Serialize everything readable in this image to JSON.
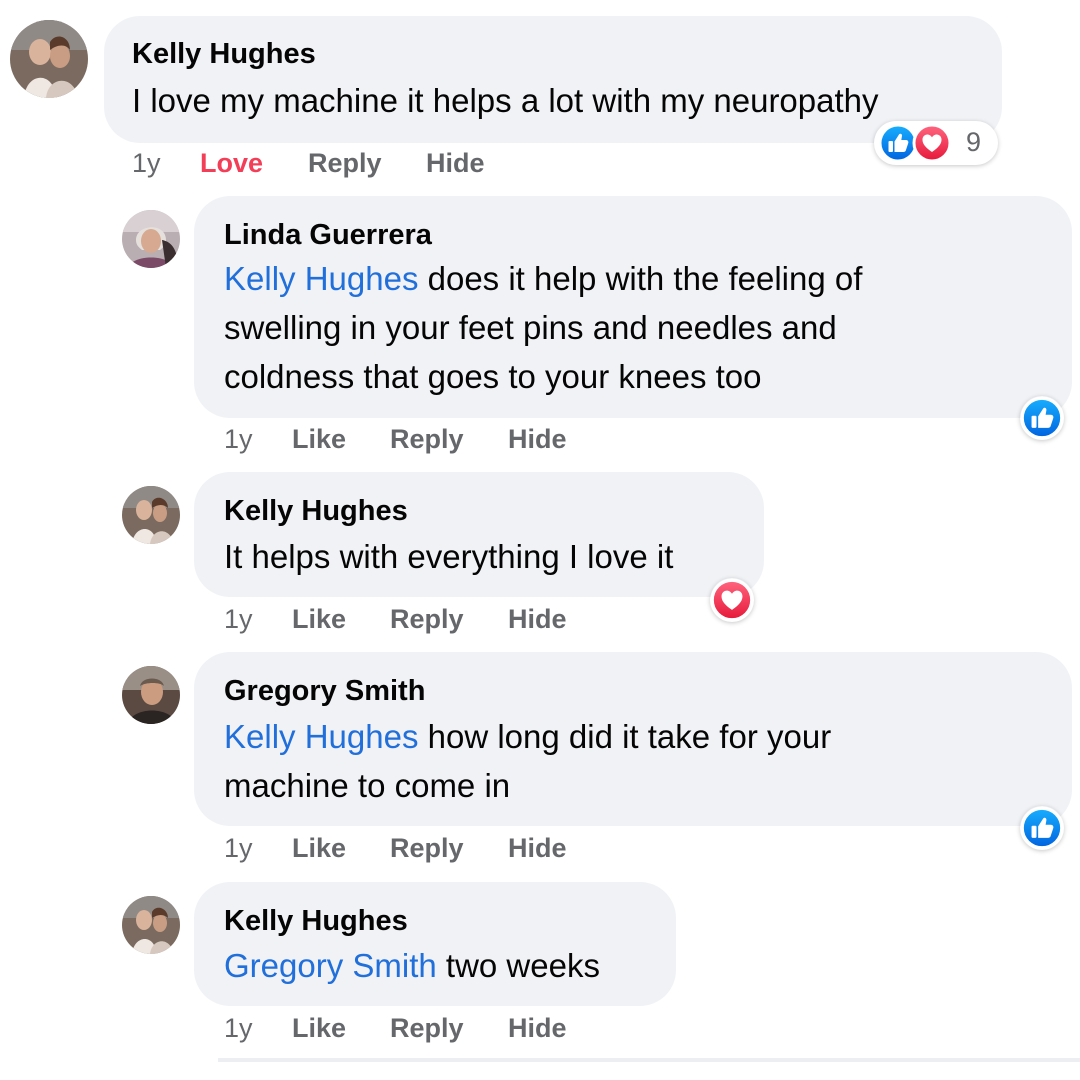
{
  "comments": [
    {
      "author": "Kelly Hughes",
      "mention": "",
      "text": "I love my machine it helps a lot with my neuropathy",
      "time": "1y",
      "like_label": "Love",
      "reply_label": "Reply",
      "hide_label": "Hide",
      "reactions": [
        "like",
        "love"
      ],
      "reaction_count": "9"
    },
    {
      "author": "Linda Guerrera",
      "mention": "Kelly Hughes",
      "text_line1": " does it help with the feeling of",
      "text_line2": "swelling in your feet pins and needles and",
      "text_line3": "coldness that goes to your knees too",
      "time": "1y",
      "like_label": "Like",
      "reply_label": "Reply",
      "hide_label": "Hide",
      "reactions": [
        "like"
      ]
    },
    {
      "author": "Kelly Hughes",
      "mention": "",
      "text": "It helps with everything I love it",
      "time": "1y",
      "like_label": "Like",
      "reply_label": "Reply",
      "hide_label": "Hide",
      "reactions": [
        "love"
      ]
    },
    {
      "author": "Gregory Smith",
      "mention": "Kelly Hughes",
      "text_line1": " how long did it take for your",
      "text_line2": "machine to come in",
      "time": "1y",
      "like_label": "Like",
      "reply_label": "Reply",
      "hide_label": "Hide",
      "reactions": [
        "like"
      ]
    },
    {
      "author": "Kelly Hughes",
      "mention": "Gregory Smith",
      "text": " two weeks",
      "time": "1y",
      "like_label": "Like",
      "reply_label": "Reply",
      "hide_label": "Hide"
    }
  ],
  "colors": {
    "bubble": "#f0f2f5",
    "mention": "#216fdb",
    "love_active": "#f33e58",
    "like_reaction": "#1877f2",
    "love_reaction": "#f33e58",
    "action_text": "#65676b"
  }
}
